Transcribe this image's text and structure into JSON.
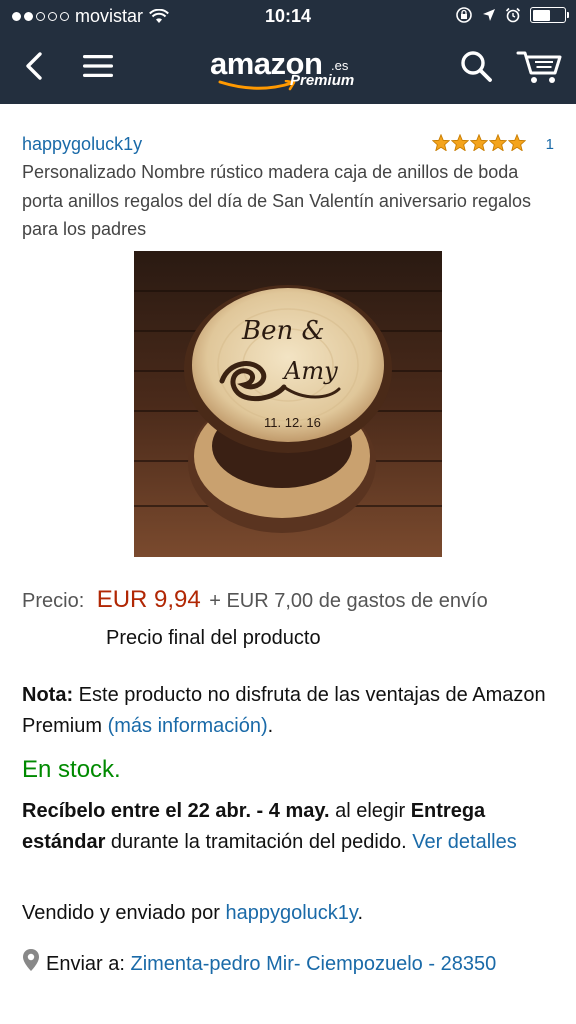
{
  "status_bar": {
    "carrier": "movistar",
    "time": "10:14",
    "battery_level": 0.55
  },
  "nav": {
    "logo_word": "amazon",
    "logo_suffix": ".es",
    "logo_premium": "Premium",
    "icons": [
      "back-chevron-icon",
      "menu-icon",
      "search-icon",
      "cart-icon"
    ]
  },
  "product": {
    "seller_name": "happygoluck1y",
    "rating_stars": 5,
    "review_count": "1",
    "title": "Personalizado Nombre rústico madera caja de anillos de boda porta anillos regalos del día de San Valentín aniversario regalos para los padres",
    "image_text": {
      "line1": "Ben &",
      "line2": "Amy",
      "date": "11. 12. 16"
    }
  },
  "price": {
    "label": "Precio:",
    "value": "EUR 9,94",
    "shipping": "+ EUR 7,00 de gastos de envío",
    "final_note": "Precio final del producto"
  },
  "nota": {
    "label": "Nota:",
    "text": " Este producto no disfruta de las ventajas de Amazon Premium ",
    "link": "(más información)",
    "end": "."
  },
  "stock": "En stock.",
  "delivery": {
    "bold1": "Recíbelo entre el 22 abr. - 4 may.",
    "text1": " al elegir ",
    "bold2": "Entrega estándar",
    "text2": " durante la tramitación del pedido. ",
    "link": "Ver detalles"
  },
  "sold_by": {
    "text": "Vendido y enviado por ",
    "link": "happygoluck1y",
    "end": "."
  },
  "ship_to": {
    "label": "Enviar a: ",
    "address": "Zimenta-pedro Mir- Ciempozuelo - 28350"
  },
  "colors": {
    "header": "#232f3e",
    "link": "#1a6aa8",
    "price": "#b12704",
    "in_stock": "#008a00",
    "stars": "#f4a41d",
    "amazon_arrow": "#f90"
  }
}
